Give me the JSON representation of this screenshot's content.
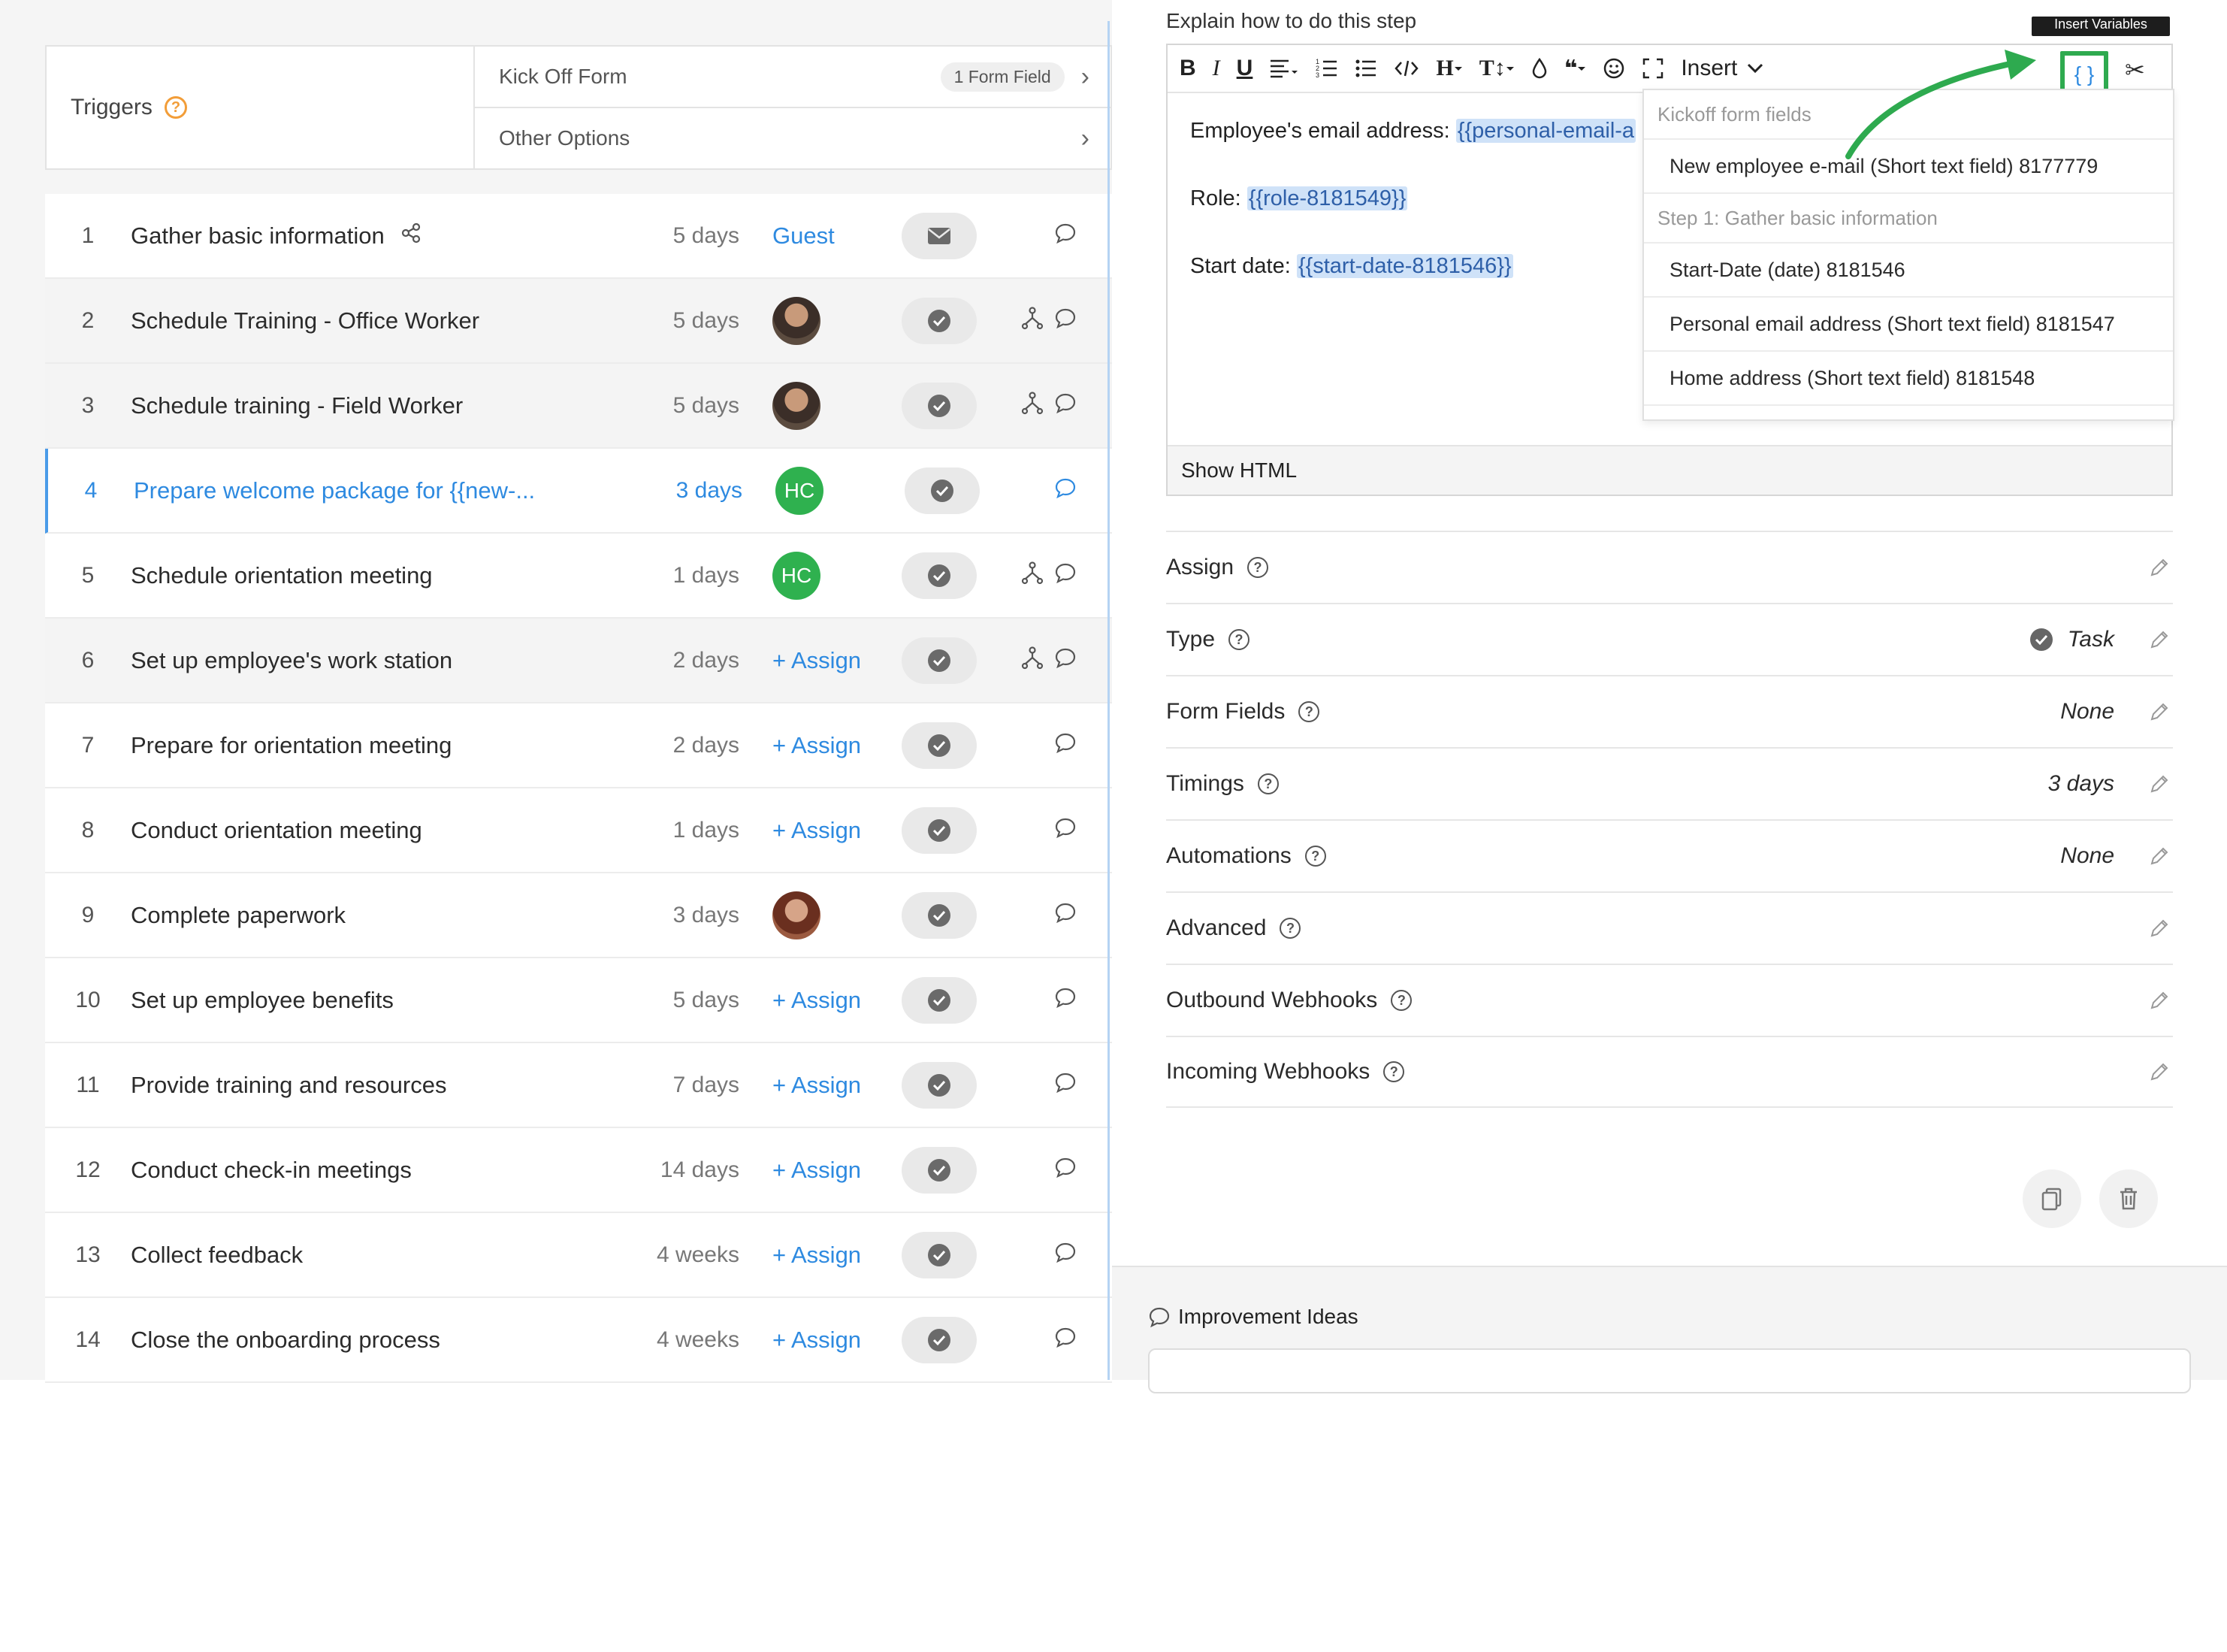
{
  "triggers": {
    "label": "Triggers",
    "help_icon": "question-circle-icon",
    "kickoff_label": "Kick Off Form",
    "kickoff_badge": "1 Form Field",
    "other_options_label": "Other Options"
  },
  "steps": [
    {
      "num": "1",
      "title": "Gather basic information",
      "duration": "5 days",
      "assignee_type": "text",
      "assignee": "Guest",
      "has_share": true,
      "has_branch": false
    },
    {
      "num": "2",
      "title": "Schedule Training - Office Worker",
      "duration": "5 days",
      "assignee_type": "photo",
      "assignee": "",
      "has_share": false,
      "has_branch": true
    },
    {
      "num": "3",
      "title": "Schedule training - Field Worker",
      "duration": "5 days",
      "assignee_type": "photo",
      "assignee": "",
      "has_share": false,
      "has_branch": true
    },
    {
      "num": "4",
      "title": "Prepare welcome package for {{new-...",
      "duration": "3 days",
      "assignee_type": "initials",
      "assignee": "HC",
      "has_share": false,
      "has_branch": false,
      "active": true
    },
    {
      "num": "5",
      "title": "Schedule orientation meeting",
      "duration": "1 days",
      "assignee_type": "initials",
      "assignee": "HC",
      "has_share": false,
      "has_branch": true
    },
    {
      "num": "6",
      "title": "Set up employee's work station",
      "duration": "2 days",
      "assignee_type": "assign",
      "assignee": "+ Assign",
      "has_share": false,
      "has_branch": true
    },
    {
      "num": "7",
      "title": "Prepare for orientation meeting",
      "duration": "2 days",
      "assignee_type": "assign",
      "assignee": "+ Assign",
      "has_share": false,
      "has_branch": false
    },
    {
      "num": "8",
      "title": "Conduct orientation meeting",
      "duration": "1 days",
      "assignee_type": "assign",
      "assignee": "+ Assign",
      "has_share": false,
      "has_branch": false
    },
    {
      "num": "9",
      "title": "Complete paperwork",
      "duration": "3 days",
      "assignee_type": "photo2",
      "assignee": "",
      "has_share": false,
      "has_branch": false
    },
    {
      "num": "10",
      "title": "Set up employee benefits",
      "duration": "5 days",
      "assignee_type": "assign",
      "assignee": "+ Assign",
      "has_share": false,
      "has_branch": false
    },
    {
      "num": "11",
      "title": "Provide training and resources",
      "duration": "7 days",
      "assignee_type": "assign",
      "assignee": "+ Assign",
      "has_share": false,
      "has_branch": false
    },
    {
      "num": "12",
      "title": "Conduct check-in meetings",
      "duration": "14 days",
      "assignee_type": "assign",
      "assignee": "+ Assign",
      "has_share": false,
      "has_branch": false
    },
    {
      "num": "13",
      "title": "Collect feedback",
      "duration": "4 weeks",
      "assignee_type": "assign",
      "assignee": "+ Assign",
      "has_share": false,
      "has_branch": false
    },
    {
      "num": "14",
      "title": "Close the onboarding process",
      "duration": "4 weeks",
      "assignee_type": "assign",
      "assignee": "+ Assign",
      "has_share": false,
      "has_branch": false
    }
  ],
  "editor": {
    "explain_label": "Explain how to do this step",
    "tooltip": "Insert Variables",
    "insert_label": "Insert",
    "line1_label": "Employee's email address: ",
    "line1_var": "{{personal-email-a",
    "line2_label": "Role: ",
    "line2_var": "{{role-8181549}}",
    "line3_label": "Start date: ",
    "line3_var": "{{start-date-8181546}}",
    "show_html": "Show HTML"
  },
  "dropdown": {
    "group1": "Kickoff form fields",
    "item1": "New employee e-mail (Short text field) 8177779",
    "group2": "Step 1: Gather basic information",
    "item2": "Start-Date (date) 8181546",
    "item3": "Personal email address (Short text field) 8181547",
    "item4": "Home address (Short text field) 8181548"
  },
  "properties": {
    "assign": {
      "label": "Assign",
      "value": ""
    },
    "type": {
      "label": "Type",
      "value": "Task"
    },
    "form_fields": {
      "label": "Form Fields",
      "value": "None"
    },
    "timings": {
      "label": "Timings",
      "value": "3 days"
    },
    "automations": {
      "label": "Automations",
      "value": "None"
    },
    "advanced": {
      "label": "Advanced",
      "value": ""
    },
    "outbound": {
      "label": "Outbound Webhooks",
      "value": ""
    },
    "incoming": {
      "label": "Incoming Webhooks",
      "value": ""
    }
  },
  "improvement": {
    "title": "Improvement Ideas"
  },
  "colors": {
    "accent": "#2e8ae0",
    "highlight_green": "#2eaa4f",
    "trigger_orange": "#f29d38",
    "hc_avatar": "#2fb14f"
  }
}
